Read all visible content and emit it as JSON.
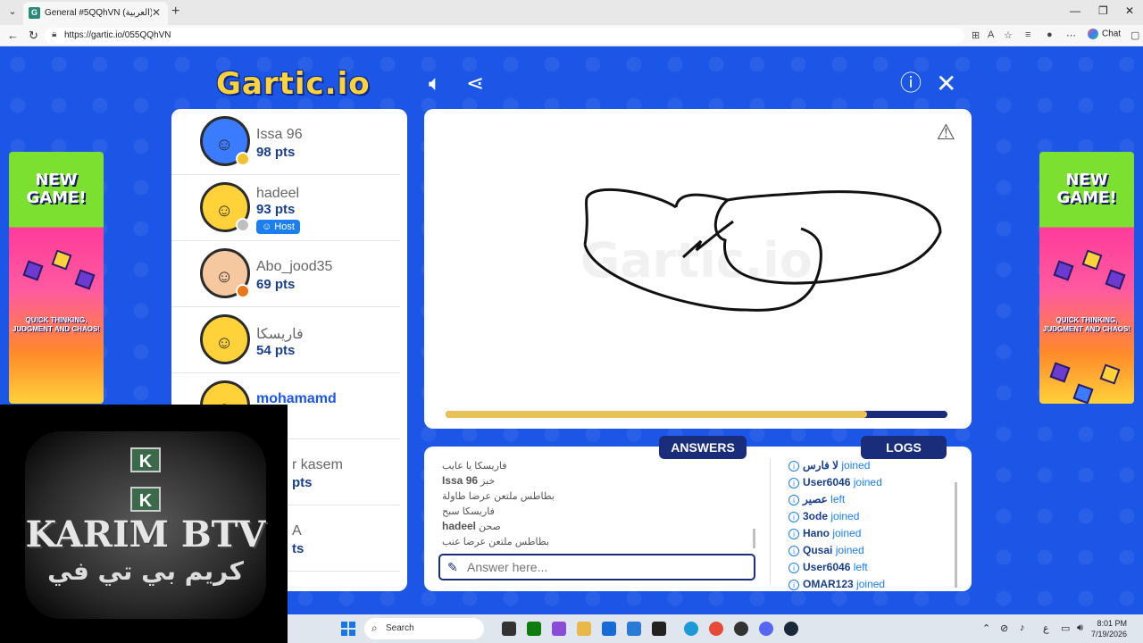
{
  "browser": {
    "tab_title": "General #5QQhVN (العربية) - Gartic",
    "url": "https://gartic.io/055QQhVN",
    "chat_label": "Chat"
  },
  "game": {
    "logo": "Gartic.io",
    "warning_icon": "warning-triangle-icon"
  },
  "players": [
    {
      "name": "Issa 96",
      "pts": "98 pts",
      "status_color": "#f2c12e",
      "host": ""
    },
    {
      "name": "hadeel",
      "pts": "93 pts",
      "status_color": "#bfbfbf",
      "host": "Host"
    },
    {
      "name": "Abo_jood35",
      "pts": "69 pts",
      "status_color": "#e8761b",
      "host": ""
    },
    {
      "name": "فاريسكا",
      "pts": "54 pts",
      "status_color": "",
      "host": ""
    },
    {
      "name": "mohamamd",
      "pts": "pts",
      "status_color": "",
      "host": ""
    },
    {
      "name": "r kasem",
      "pts": "pts",
      "status_color": "",
      "host": ""
    },
    {
      "name": "A",
      "pts": "ts",
      "status_color": "",
      "host": ""
    }
  ],
  "timer": {
    "fraction": 0.84
  },
  "tabs": {
    "answers": "ANSWERS",
    "logs": "LOGS"
  },
  "answers": [
    {
      "who": "",
      "text": "فاريسكا يا عايب"
    },
    {
      "who": "Issa 96",
      "text": "خبز"
    },
    {
      "who": "",
      "text": "بطاطس ملتعن عرضا طاولة"
    },
    {
      "who": "",
      "text": "فاريسكا سبح"
    },
    {
      "who": "hadeel",
      "text": "صحن"
    },
    {
      "who": "",
      "text": "بطاطس ملتعن عرضا عنب"
    }
  ],
  "answer_input": {
    "placeholder": "Answer here..."
  },
  "logs": [
    {
      "who": "لا فارس",
      "action": "joined"
    },
    {
      "who": "User6046",
      "action": "joined"
    },
    {
      "who": "عصير",
      "action": "left"
    },
    {
      "who": "3ode",
      "action": "joined"
    },
    {
      "who": "Hano",
      "action": "joined"
    },
    {
      "who": "Qusai",
      "action": "joined"
    },
    {
      "who": "User6046",
      "action": "left"
    },
    {
      "who": "OMAR123",
      "action": "joined"
    }
  ],
  "ads": {
    "headline": "NEW GAME!",
    "tagline": "QUICK THINKING, JUDGMENT AND CHAOS!"
  },
  "overlay": {
    "title": "KARIM BTV",
    "subtitle": "كريم بي تي في",
    "badge": "K"
  },
  "taskbar": {
    "search": "Search",
    "time": "8:01 PM",
    "date": "7/19/2026",
    "lang": "ع"
  }
}
